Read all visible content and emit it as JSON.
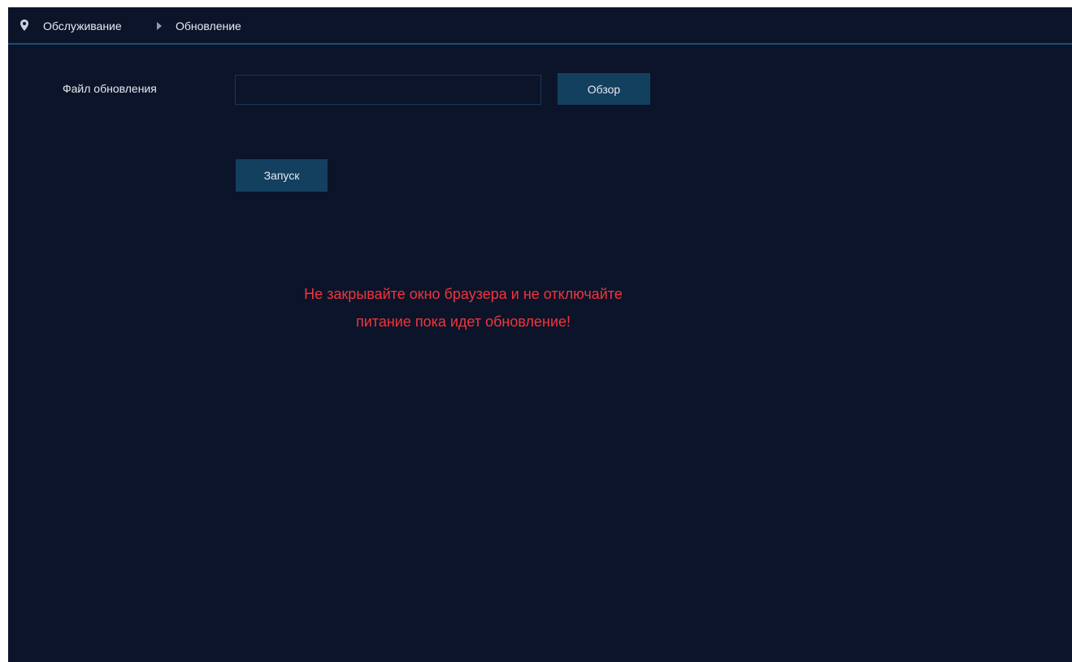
{
  "breadcrumb": {
    "items": [
      "Обслуживание",
      "Обновление"
    ]
  },
  "icons": {
    "location": "map-pin-icon",
    "separator": "caret-right-icon"
  },
  "form": {
    "file_label": "Файл обновления",
    "file_value": "",
    "browse_label": "Обзор",
    "start_label": "Запуск"
  },
  "warning": {
    "line1": "Не закрывайте окно браузера и не отключайте",
    "line2": "питание пока идет обновление!"
  },
  "colors": {
    "background": "#0c142a",
    "accent_border": "#14507a",
    "button": "#14405f",
    "warning_text": "#f2343d"
  }
}
